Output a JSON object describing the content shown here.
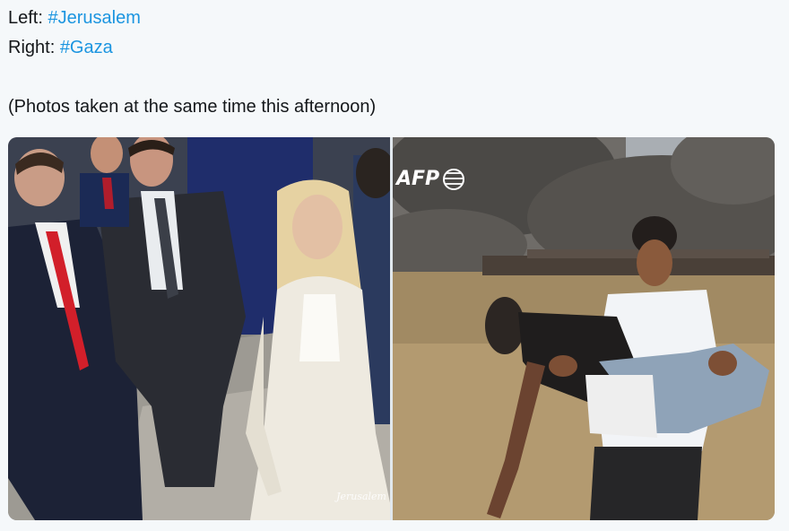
{
  "tweet": {
    "line1_prefix": "Left: ",
    "line1_hashtag": "#Jerusalem",
    "line2_prefix": "Right: ",
    "line2_hashtag": "#Gaza",
    "caption": "(Photos taken at the same time this afternoon)"
  },
  "media": {
    "left_photo": {
      "description_icon": "photo-jerusalem",
      "watermark": "Jerusalem"
    },
    "right_photo": {
      "description_icon": "photo-gaza",
      "agency_logo": "AFP"
    }
  },
  "colors": {
    "background": "#f5f8fa",
    "text": "#14171a",
    "hashtag": "#1b95e0"
  }
}
